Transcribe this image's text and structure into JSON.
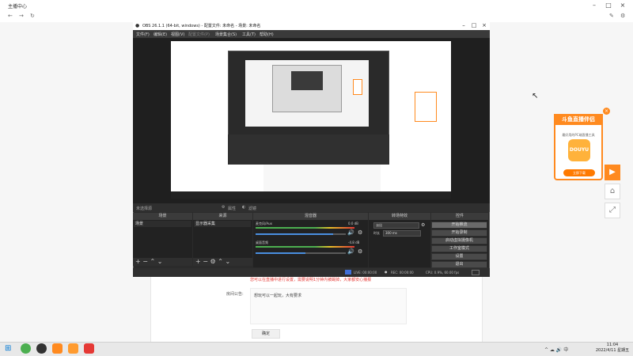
{
  "browser": {
    "title": "主播中心",
    "warning": "您可以在直播中进行设置，需要说明1分钟内被踢掉，大家都安心播报",
    "notice_label": "房间公告:",
    "notice_text": "想玩可以一起玩，大有要求",
    "confirm_label": "确定"
  },
  "ad": {
    "title": "斗鱼直播伴侣",
    "subtitle": "最好用的PC端直播工具",
    "logo_text": "DOUYU",
    "download_label": "立即下载",
    "close_label": "×"
  },
  "obs": {
    "title": "OBS 26.1.1 (64-bit, windows) - 配置文件: 未命名 - 场景: 未命名",
    "menu": [
      "文件(F)",
      "编辑(E)",
      "视图(V)",
      "配置文件(P)",
      "场景集合(S)",
      "工具(T)",
      "帮助(H)"
    ],
    "status_left": "未选择源",
    "props_label": "属性",
    "filters_label": "滤镜",
    "docks": {
      "scenes": "场景",
      "sources": "来源",
      "mixer": "混音器",
      "transitions": "转场特效",
      "controls": "控件"
    },
    "scene_item": "场景",
    "source_item": "显示器采集",
    "mixer": [
      {
        "name": "麦克风/Aux",
        "db": "0.0 dB",
        "volume": 0.86
      },
      {
        "name": "桌面音频",
        "db": "-4.8 dB",
        "volume": 0.55
      }
    ],
    "transition": {
      "type": "淡出",
      "duration_label": "时长",
      "duration": "300 ms"
    },
    "controls": [
      "开始推流",
      "开始录制",
      "启动虚拟摄像机",
      "工作室模式",
      "设置",
      "退出"
    ],
    "bottom_status": {
      "live": "LIVE: 00:00:00",
      "rec": "REC: 00:00:00",
      "cpu": "CPU: 0.9%, 60.00 fps"
    }
  },
  "taskbar": {
    "time": "11:04",
    "date": "2022/4/11 星期五",
    "tray": "^ ☁ 🔊 中"
  }
}
